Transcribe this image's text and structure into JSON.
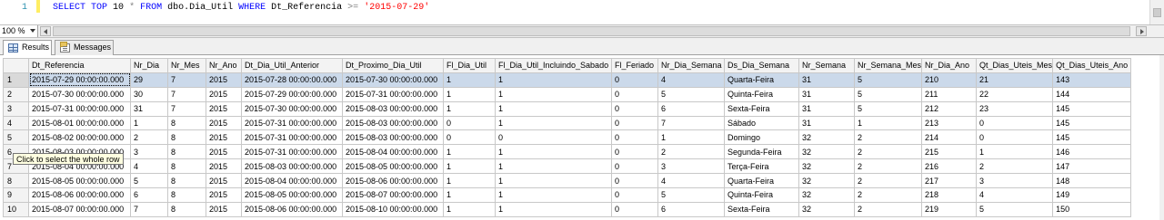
{
  "editor": {
    "line_number": "1",
    "sql": {
      "kw_select": "SELECT",
      "kw_top": "TOP",
      "top_n": " 10 ",
      "star": "*",
      "kw_from": "FROM",
      "table": " dbo.Dia_Util ",
      "kw_where": "WHERE",
      "column": " Dt_Referencia ",
      "op": ">=",
      "literal": "'2015-07-29'"
    }
  },
  "zoom": {
    "value": "100 %"
  },
  "tabs": [
    {
      "label": "Results",
      "icon": "results-grid-icon",
      "active": true
    },
    {
      "label": "Messages",
      "icon": "messages-icon",
      "active": false
    }
  ],
  "tooltip": "Click to select the whole row",
  "grid": {
    "columns": [
      "Dt_Referencia",
      "Nr_Dia",
      "Nr_Mes",
      "Nr_Ano",
      "Dt_Dia_Util_Anterior",
      "Dt_Proximo_Dia_Util",
      "Fl_Dia_Util",
      "Fl_Dia_Util_Incluindo_Sabado",
      "Fl_Feriado",
      "Nr_Dia_Semana",
      "Ds_Dia_Semana",
      "Nr_Semana",
      "Nr_Semana_Mes",
      "Nr_Dia_Ano",
      "Qt_Dias_Uteis_Mes",
      "Qt_Dias_Uteis_Ano"
    ],
    "rows": [
      {
        "n": "1",
        "cells": [
          "2015-07-29 00:00:00.000",
          "29",
          "7",
          "2015",
          "2015-07-28 00:00:00.000",
          "2015-07-30 00:00:00.000",
          "1",
          "1",
          "0",
          "4",
          "Quarta-Feira",
          "31",
          "5",
          "210",
          "21",
          "143"
        ]
      },
      {
        "n": "2",
        "cells": [
          "2015-07-30 00:00:00.000",
          "30",
          "7",
          "2015",
          "2015-07-29 00:00:00.000",
          "2015-07-31 00:00:00.000",
          "1",
          "1",
          "0",
          "5",
          "Quinta-Feira",
          "31",
          "5",
          "211",
          "22",
          "144"
        ]
      },
      {
        "n": "3",
        "cells": [
          "2015-07-31 00:00:00.000",
          "31",
          "7",
          "2015",
          "2015-07-30 00:00:00.000",
          "2015-08-03 00:00:00.000",
          "1",
          "1",
          "0",
          "6",
          "Sexta-Feira",
          "31",
          "5",
          "212",
          "23",
          "145"
        ]
      },
      {
        "n": "4",
        "cells": [
          "2015-08-01 00:00:00.000",
          "1",
          "8",
          "2015",
          "2015-07-31 00:00:00.000",
          "2015-08-03 00:00:00.000",
          "0",
          "1",
          "0",
          "7",
          "Sábado",
          "31",
          "1",
          "213",
          "0",
          "145"
        ]
      },
      {
        "n": "5",
        "cells": [
          "2015-08-02 00:00:00.000",
          "2",
          "8",
          "2015",
          "2015-07-31 00:00:00.000",
          "2015-08-03 00:00:00.000",
          "0",
          "0",
          "0",
          "1",
          "Domingo",
          "32",
          "2",
          "214",
          "0",
          "145"
        ]
      },
      {
        "n": "6",
        "cells": [
          "2015-08-03 00:00:00.000",
          "3",
          "8",
          "2015",
          "2015-07-31 00:00:00.000",
          "2015-08-04 00:00:00.000",
          "1",
          "1",
          "0",
          "2",
          "Segunda-Feira",
          "32",
          "2",
          "215",
          "1",
          "146"
        ]
      },
      {
        "n": "7",
        "cells": [
          "2015-08-04 00:00:00.000",
          "4",
          "8",
          "2015",
          "2015-08-03 00:00:00.000",
          "2015-08-05 00:00:00.000",
          "1",
          "1",
          "0",
          "3",
          "Terça-Feira",
          "32",
          "2",
          "216",
          "2",
          "147"
        ]
      },
      {
        "n": "8",
        "cells": [
          "2015-08-05 00:00:00.000",
          "5",
          "8",
          "2015",
          "2015-08-04 00:00:00.000",
          "2015-08-06 00:00:00.000",
          "1",
          "1",
          "0",
          "4",
          "Quarta-Feira",
          "32",
          "2",
          "217",
          "3",
          "148"
        ]
      },
      {
        "n": "9",
        "cells": [
          "2015-08-06 00:00:00.000",
          "6",
          "8",
          "2015",
          "2015-08-05 00:00:00.000",
          "2015-08-07 00:00:00.000",
          "1",
          "1",
          "0",
          "5",
          "Quinta-Feira",
          "32",
          "2",
          "218",
          "4",
          "149"
        ]
      },
      {
        "n": "10",
        "cells": [
          "2015-08-07 00:00:00.000",
          "7",
          "8",
          "2015",
          "2015-08-06 00:00:00.000",
          "2015-08-10 00:00:00.000",
          "1",
          "1",
          "0",
          "6",
          "Sexta-Feira",
          "32",
          "2",
          "219",
          "5",
          "150"
        ]
      }
    ]
  }
}
